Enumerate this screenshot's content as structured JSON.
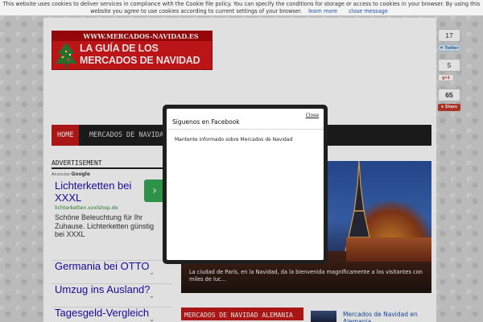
{
  "cookie_bar": {
    "message": "This website uses cookies to deliver services in compliance with the Cookie file policy. You can specify the conditions for storage or access to cookies in your browser. By using this website you agree to use cookies according to current settings of your browser.",
    "learn_more": "learn more",
    "close": "close message"
  },
  "logo": {
    "url_text": "WWW.MERCADOS-NAVIDAD.ES",
    "line1": "LA GUÍA DE LOS",
    "line2": "MERCADOS DE NAVIDAD"
  },
  "nav": {
    "items": [
      {
        "label": "HOME",
        "active": true
      },
      {
        "label": "MERCADOS DE NAVIDAD",
        "active": false
      }
    ]
  },
  "share": {
    "twitter_count": "17",
    "twitter_label": "Twitter",
    "google_count": "5",
    "google_label": "g+1",
    "stumble_count": "65",
    "stumble_label": "Share"
  },
  "sidebar": {
    "heading": "ADVERTISEMENT",
    "ads_by": "Anuncios",
    "ads_brand": "Google",
    "main_ad": {
      "title": "Lichterketten bei XXXL",
      "url": "lichterketten.xxxlshop.de",
      "description": "Schöne Beleuchtung für Ihr Zuhause. Lichterketten günstig bei XXXL",
      "arrow": "›"
    },
    "links": [
      {
        "text": "Germania bei OTTO",
        "chevron": "⌄"
      },
      {
        "text": "Umzug ins Ausland?",
        "chevron": "⌄"
      },
      {
        "text": "Tagesgeld-Vergleich",
        "chevron": "⌄"
      }
    ]
  },
  "slider": {
    "caption": "La ciudad de París, en la Navidad, da la bienvenida magníficamente a los visitantes con miles de luc..."
  },
  "section": {
    "heading": "MERCADOS DE NAVIDAD ALEMANIA",
    "related_title": "Mercados de Navidad en Alemania"
  },
  "modal": {
    "close": "Close",
    "title": "Síguenos en Facebook",
    "body": "Mantente informado sobre Mercados de Navidad"
  },
  "colors": {
    "brand_red": "#d5191c",
    "nav_bg": "#1e1e1e",
    "link_blue": "#1a0dab"
  }
}
